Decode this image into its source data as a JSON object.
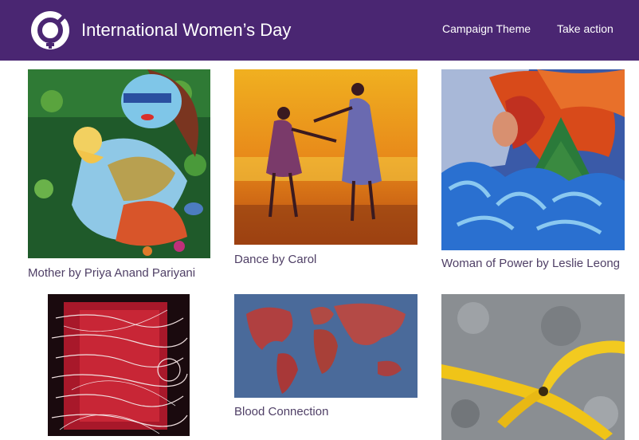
{
  "header": {
    "title": "International Women’s Day",
    "background": "#4a2672",
    "logo_icon": "iwd-symbol-icon",
    "nav": [
      {
        "label": "Campaign Theme"
      },
      {
        "label": "Take action"
      }
    ]
  },
  "gallery": {
    "items": [
      {
        "caption": "Mother by Priya Anand Pariyani",
        "image": "painting-mother"
      },
      {
        "caption": "Dance by Carol",
        "image": "painting-dance"
      },
      {
        "caption": "Woman of Power by Leslie Leong",
        "image": "painting-woman-of-power"
      },
      {
        "caption": "",
        "image": "painting-red-script"
      },
      {
        "caption": "Blood Connection",
        "image": "painting-world-map"
      },
      {
        "caption": "",
        "image": "photo-banana-peel"
      }
    ]
  }
}
